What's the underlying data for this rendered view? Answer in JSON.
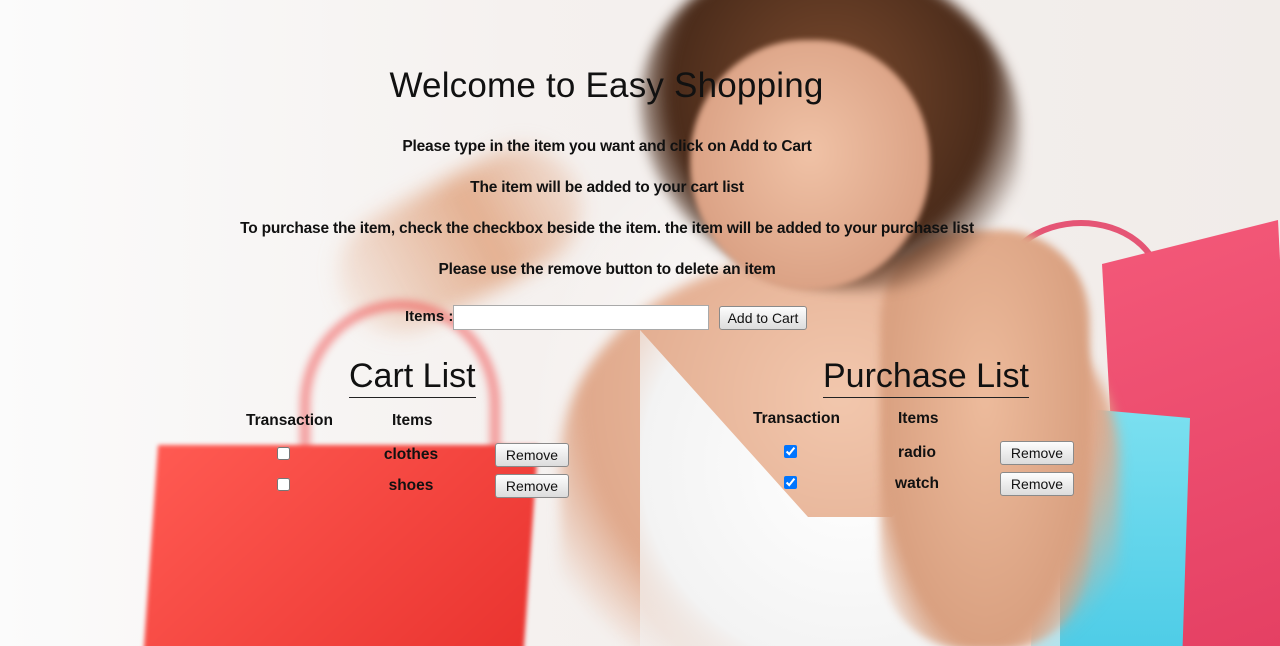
{
  "page": {
    "title": "Welcome to Easy Shopping",
    "instructions": [
      "Please type in the item you want and click on Add to Cart",
      "The item will be added to your cart list",
      "To purchase the item, check the checkbox beside the item. the item will be added to your purchase list",
      "Please use the remove button to delete an item"
    ]
  },
  "add_form": {
    "label": "Items :",
    "input_value": "",
    "button_label": "Add to Cart"
  },
  "cart": {
    "title": "Cart List",
    "headers": {
      "transaction": "Transaction",
      "items": "Items"
    },
    "rows": [
      {
        "item": "clothes",
        "checked": false,
        "remove_label": "Remove"
      },
      {
        "item": "shoes",
        "checked": false,
        "remove_label": "Remove"
      }
    ]
  },
  "purchase": {
    "title": "Purchase List",
    "headers": {
      "transaction": "Transaction",
      "items": "Items"
    },
    "rows": [
      {
        "item": "radio",
        "checked": true,
        "remove_label": "Remove"
      },
      {
        "item": "watch",
        "checked": true,
        "remove_label": "Remove"
      }
    ]
  },
  "background": {
    "image": "woman-with-shopping-bags-photo"
  }
}
